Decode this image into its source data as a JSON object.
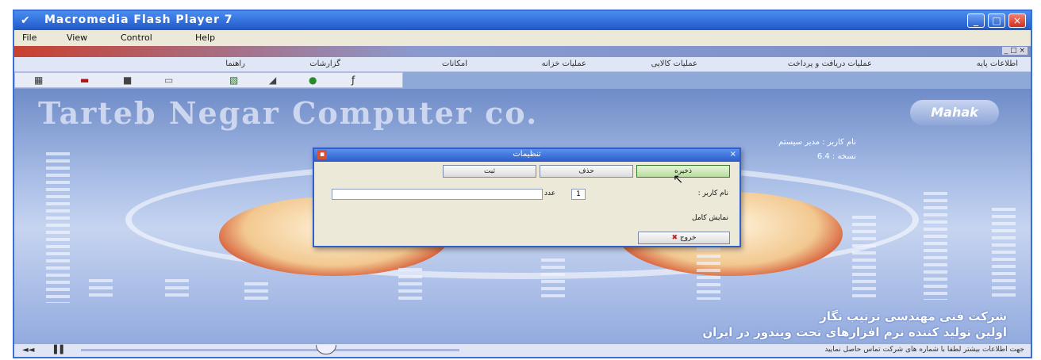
{
  "window": {
    "title": "Macromedia Flash Player 7",
    "minimize": "_",
    "maximize": "□",
    "close": "×"
  },
  "menu": [
    "File",
    "View",
    "Control",
    "Help"
  ],
  "inner_window_buttons": "_ □ ×",
  "nav_items": [
    "اطلاعات پایه",
    "عملیات دریافت و پرداخت",
    "عملیات کالایی",
    "عملیات خزانه",
    "امکانات",
    "گزارشات",
    "راهنما"
  ],
  "brand": {
    "name": "Tarteb Negar Computer co.",
    "logo": "Mahak"
  },
  "info_lines": [
    "نام کاربر : مدیر سیستم",
    "نسخه : 6.4"
  ],
  "slogans": [
    "شرکت فنی مهندسی ترتیب نگار",
    "اولین تولید کننده نرم افزارهای تحت ویندوز در ایران"
  ],
  "status_text": "جهت اطلاعات بیشتر لطفا با شماره های شرکت تماس حاصل نمایید",
  "player_controls": {
    "rewind": "◄◄",
    "play": "▌▌"
  },
  "dialog": {
    "title": "تنظیمات",
    "close": "×",
    "buttons": [
      "ذخیره",
      "حذف",
      "ثبت"
    ],
    "field_label": "نام کاربر :",
    "field_small": "1",
    "field_suffix": "عدد",
    "checkbox_label": "نمایش کامل",
    "exit_button": "خروج",
    "exit_icon": "✖"
  }
}
